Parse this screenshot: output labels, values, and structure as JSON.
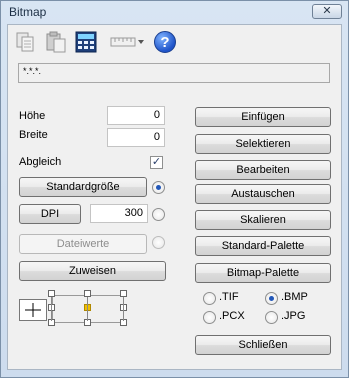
{
  "window": {
    "title": "Bitmap",
    "close_label": "✕"
  },
  "toolbar": {
    "icons": [
      "copy-icon",
      "paste-icon",
      "calculator-icon",
      "ruler-dropdown-icon",
      "help-icon"
    ],
    "help_glyph": "?"
  },
  "path": {
    "value": "*.*.*."
  },
  "size": {
    "hoehe_label": "Höhe",
    "hoehe_value": "0",
    "breite_label": "Breite",
    "breite_value": "0",
    "abgleich_label": "Abgleich",
    "abgleich_checked": true
  },
  "buttons": {
    "standardgroesse": "Standardgröße",
    "dpi": "DPI",
    "dpi_value": "300",
    "dateiwerte": "Dateiwerte",
    "zuweisen": "Zuweisen"
  },
  "actions": [
    "Einfügen",
    "Selektieren",
    "Bearbeiten",
    "Austauschen",
    "Skalieren",
    "Standard-Palette",
    "Bitmap-Palette"
  ],
  "formats": [
    {
      "label": ".TIF",
      "checked": false
    },
    {
      "label": ".BMP",
      "checked": true
    },
    {
      "label": ".PCX",
      "checked": false
    },
    {
      "label": ".JPG",
      "checked": false
    }
  ],
  "close_button": "Schließen",
  "alignment": {
    "selected": "center"
  }
}
